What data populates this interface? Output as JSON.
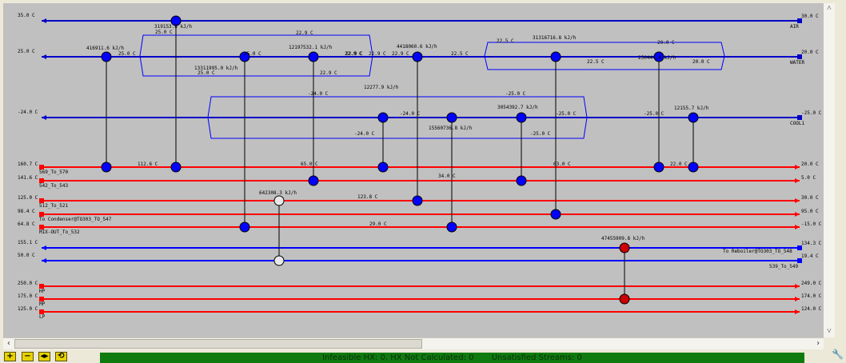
{
  "colors": {
    "canvas": "#c0c0c0",
    "hot": "#ff0000",
    "cold": "#0000ff",
    "util_cold": "#0000c8",
    "util_hot": "#ff0000",
    "node_cooler": "#0000ff",
    "node_heater": "#cc0000",
    "node_exchanger": "#e8e8e8",
    "status": "#0f7b0f"
  },
  "streams": [
    {
      "id": "air",
      "kind": "util_cold",
      "dir": "left",
      "label": "AIR",
      "in_temp": "30.0 C",
      "out_temp": "35.0 C"
    },
    {
      "id": "water",
      "kind": "util_cold",
      "dir": "left",
      "label": "WATER",
      "in_temp": "20.0 C",
      "out_temp": "25.0 C"
    },
    {
      "id": "cool1",
      "kind": "util_cold",
      "dir": "left",
      "label": "COOL1",
      "in_temp": "-25.0 C",
      "out_temp": "-24.0 C"
    },
    {
      "id": "s569",
      "kind": "hot",
      "dir": "right",
      "label": "569_To_570",
      "in_temp": "160.7 C",
      "out_temp": "20.0 C"
    },
    {
      "id": "s542",
      "kind": "hot",
      "dir": "right",
      "label": "542_To_543",
      "in_temp": "141.6 C",
      "out_temp": "5.0 C"
    },
    {
      "id": "s512",
      "kind": "hot",
      "dir": "right",
      "label": "512_To_521",
      "in_temp": "125.0 C",
      "out_temp": "30.0 C"
    },
    {
      "id": "scond",
      "kind": "hot",
      "dir": "right",
      "label": "To Condenser@TO303_TO_547",
      "in_temp": "98.4 C",
      "out_temp": "95.0 C"
    },
    {
      "id": "smix",
      "kind": "hot",
      "dir": "right",
      "label": "MIX-OUT_To_532",
      "in_temp": "64.8 C",
      "out_temp": "-15.0 C"
    },
    {
      "id": "sreb",
      "kind": "cold",
      "dir": "left",
      "label": "To Reboiler@TO303_TO_548",
      "in_temp": "134.3 C",
      "out_temp": "155.1 C"
    },
    {
      "id": "s539",
      "kind": "cold",
      "dir": "left",
      "label": "539_To_549",
      "in_temp": "19.4 C",
      "out_temp": "50.0 C"
    },
    {
      "id": "hp",
      "kind": "util_hot",
      "dir": "right",
      "label": "HP",
      "in_temp": "250.0 C",
      "out_temp": "249.0 C"
    },
    {
      "id": "mp",
      "kind": "util_hot",
      "dir": "right",
      "label": "MP",
      "in_temp": "175.0 C",
      "out_temp": "174.0 C"
    },
    {
      "id": "lp",
      "kind": "util_hot",
      "dir": "right",
      "label": "LP",
      "in_temp": "125.0 C",
      "out_temp": "124.0 C"
    }
  ],
  "exchangers": [
    {
      "type": "cooler",
      "duty": "416911.6 kJ/h",
      "top": "water",
      "bottom": "s569"
    },
    {
      "type": "cooler",
      "duty": "319153.8 kJ/h",
      "top": "air",
      "bottom": "s569"
    },
    {
      "type": "cooler",
      "duty": "13311995.0 kJ/h",
      "top": "water",
      "bottom": "smix"
    },
    {
      "type": "cooler",
      "duty": "12197532.1 kJ/h",
      "top": "water",
      "bottom": "s542"
    },
    {
      "type": "cooler",
      "duty": "12277.9 kJ/h",
      "top": "cool1",
      "bottom": "s569"
    },
    {
      "type": "cooler",
      "duty": "4418060.6 kJ/h",
      "top": "water",
      "bottom": "s512"
    },
    {
      "type": "cooler",
      "duty": "15560736.8 kJ/h",
      "top": "cool1",
      "bottom": "smix"
    },
    {
      "type": "cooler",
      "duty": "3054392.7 kJ/h",
      "top": "cool1",
      "bottom": "s542"
    },
    {
      "type": "cooler",
      "duty": "31316716.8 kJ/h",
      "top": "water",
      "bottom": "scond"
    },
    {
      "type": "cooler",
      "duty": "250444.4 kJ/h",
      "top": "water",
      "bottom": "s569"
    },
    {
      "type": "cooler",
      "duty": "12155.7 kJ/h",
      "top": "cool1",
      "bottom": "s569"
    },
    {
      "type": "exchanger",
      "duty": "642308.3 kJ/h",
      "top": "s512",
      "bottom": "s539"
    },
    {
      "type": "heater",
      "duty": "47455909.8 kJ/h",
      "top": "sreb",
      "bottom": "mp"
    }
  ],
  "temp_labels": [
    "25.0 C",
    "25.0 C",
    "22.9 C",
    "25.0 C",
    "22.9 C",
    "25.0 C",
    "22.9 C",
    "22.9 C",
    "22.9 C",
    "22.9 C",
    "22.5 C",
    "22.5 C",
    "20.0 C",
    "22.5 C",
    "20.0 C",
    "-24.0 C",
    "-24.0 C",
    "-24.0 C",
    "-25.0 C",
    "-25.0 C",
    "-25.0 C",
    "-25.0 C",
    "112.6 C",
    "65.0 C",
    "63.0 C",
    "22.0 C",
    "34.0 C",
    "123.8 C",
    "29.0 C"
  ],
  "status": {
    "text": "Infeasible HX: 0, HX Not Calculated: 0       Unsatisfied Streams: 0"
  },
  "toolbar": {
    "zoom_in": "+",
    "zoom_out": "−",
    "fit": "◂▸",
    "refresh": "⟲"
  },
  "scroll": {
    "left": "‹",
    "right": "›",
    "up": "˄",
    "down": "˅"
  }
}
